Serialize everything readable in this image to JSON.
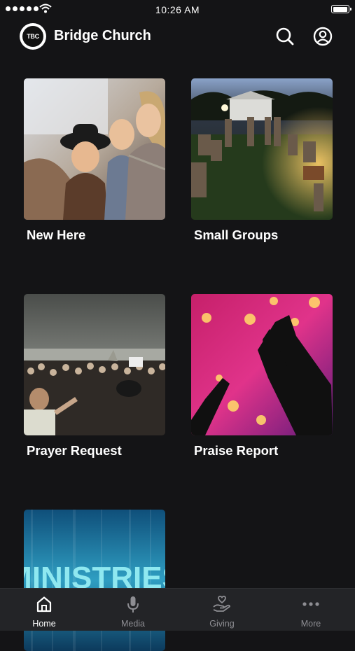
{
  "status_bar": {
    "time": "10:26 AM",
    "battery_level": 0.95
  },
  "header": {
    "logo_text": "TBC",
    "title": "Bridge Church"
  },
  "tiles": [
    {
      "label": "New Here"
    },
    {
      "label": "Small Groups"
    },
    {
      "label": "Prayer Request"
    },
    {
      "label": "Praise Report"
    },
    {
      "label": "",
      "image_text": "MINISTRIES"
    }
  ],
  "tab_bar": {
    "items": [
      {
        "label": "Home",
        "icon": "home-icon",
        "active": true
      },
      {
        "label": "Media",
        "icon": "microphone-icon",
        "active": false
      },
      {
        "label": "Giving",
        "icon": "giving-hand-heart-icon",
        "active": false
      },
      {
        "label": "More",
        "icon": "more-dots-icon",
        "active": false
      }
    ]
  },
  "colors": {
    "background": "#141416",
    "tab_bar": "#232427",
    "active": "#ffffff",
    "inactive": "#8e8e93"
  }
}
